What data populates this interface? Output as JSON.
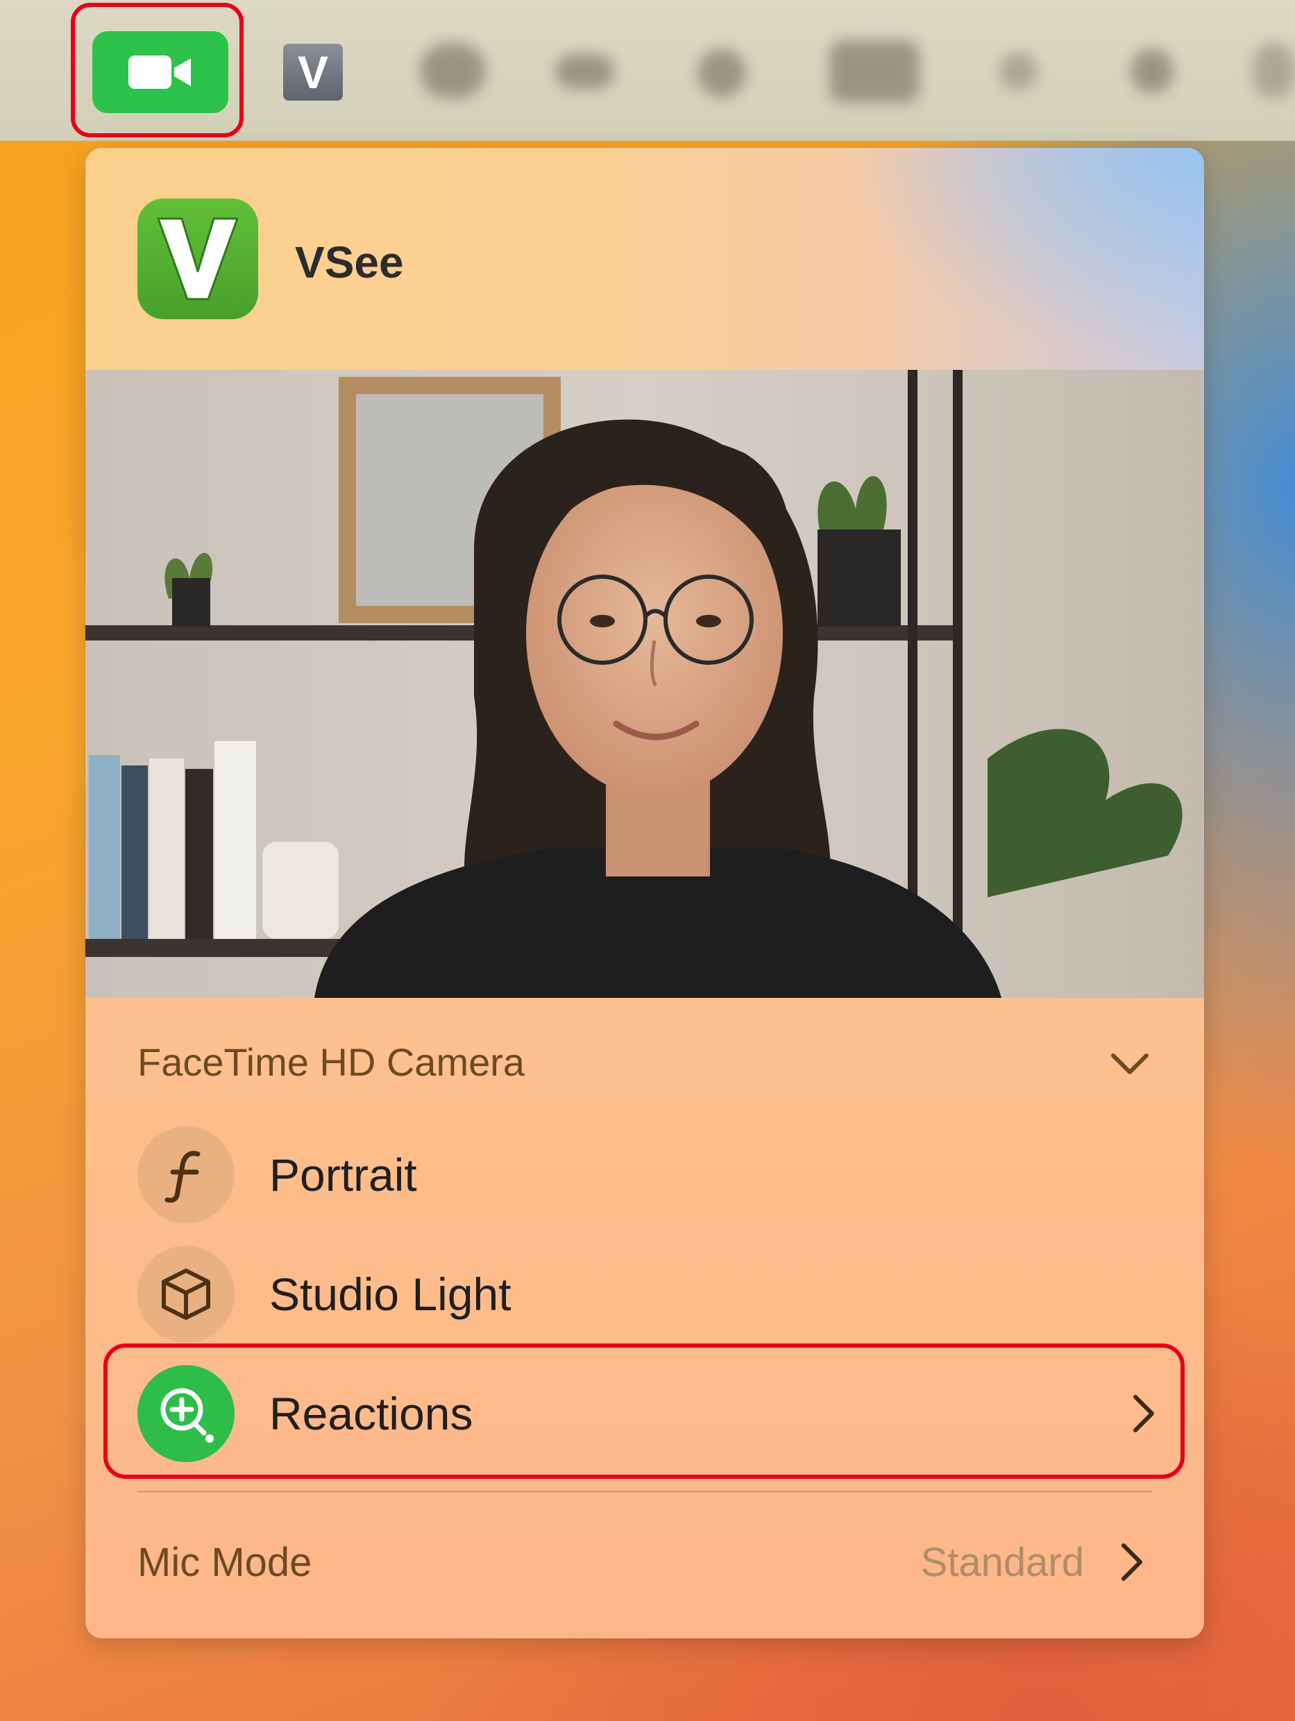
{
  "menubar": {
    "facetime_icon": "video-camera-icon",
    "vsee_status_letter": "V"
  },
  "panel": {
    "app_name": "VSee",
    "app_icon_letter": "V",
    "camera_section_title": "FaceTime HD Camera",
    "effects": [
      {
        "label": "Portrait",
        "icon": "f-aperture-icon"
      },
      {
        "label": "Studio Light",
        "icon": "cube-icon"
      },
      {
        "label": "Reactions",
        "icon": "reactions-icon"
      }
    ],
    "mic_mode_label": "Mic Mode",
    "mic_mode_value": "Standard"
  },
  "colors": {
    "facetime_green": "#2dc24a",
    "vsee_green": "#52ad31",
    "highlight_red": "#e8001a",
    "reactions_green": "#2ebd49"
  }
}
